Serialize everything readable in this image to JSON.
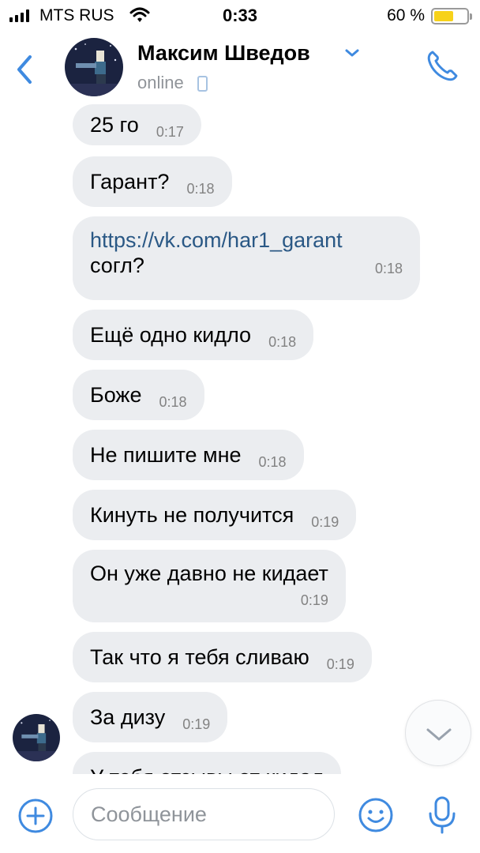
{
  "status_bar": {
    "carrier": "MTS RUS",
    "time": "0:33",
    "battery": "60 %",
    "battery_level": 0.6
  },
  "header": {
    "contact_name": "Максим Шведов",
    "contact_status": "online"
  },
  "messages": [
    {
      "text": "25 го",
      "time": "0:17"
    },
    {
      "text": "Гарант?",
      "time": "0:18"
    },
    {
      "link": "https://vk.com/har1_garant",
      "text": "согл?",
      "time": "0:18"
    },
    {
      "text": "Ещё одно кидло",
      "time": "0:18"
    },
    {
      "text": "Боже",
      "time": "0:18"
    },
    {
      "text": "Не пишите мне",
      "time": "0:18"
    },
    {
      "text": "Кинуть не получится",
      "time": "0:19"
    },
    {
      "text": "Он уже давно не кидает",
      "time": "0:19"
    },
    {
      "text": "Так что я тебя сливаю",
      "time": "0:19"
    },
    {
      "text": "За дизу",
      "time": "0:19"
    },
    {
      "text": "У тебя отзывы от кидал"
    }
  ],
  "composer": {
    "placeholder": "Сообщение"
  },
  "colors": {
    "accent": "#3f8ae0",
    "bubble": "#ebedf0",
    "link": "#2a5885",
    "battery": "#f7d21a"
  }
}
